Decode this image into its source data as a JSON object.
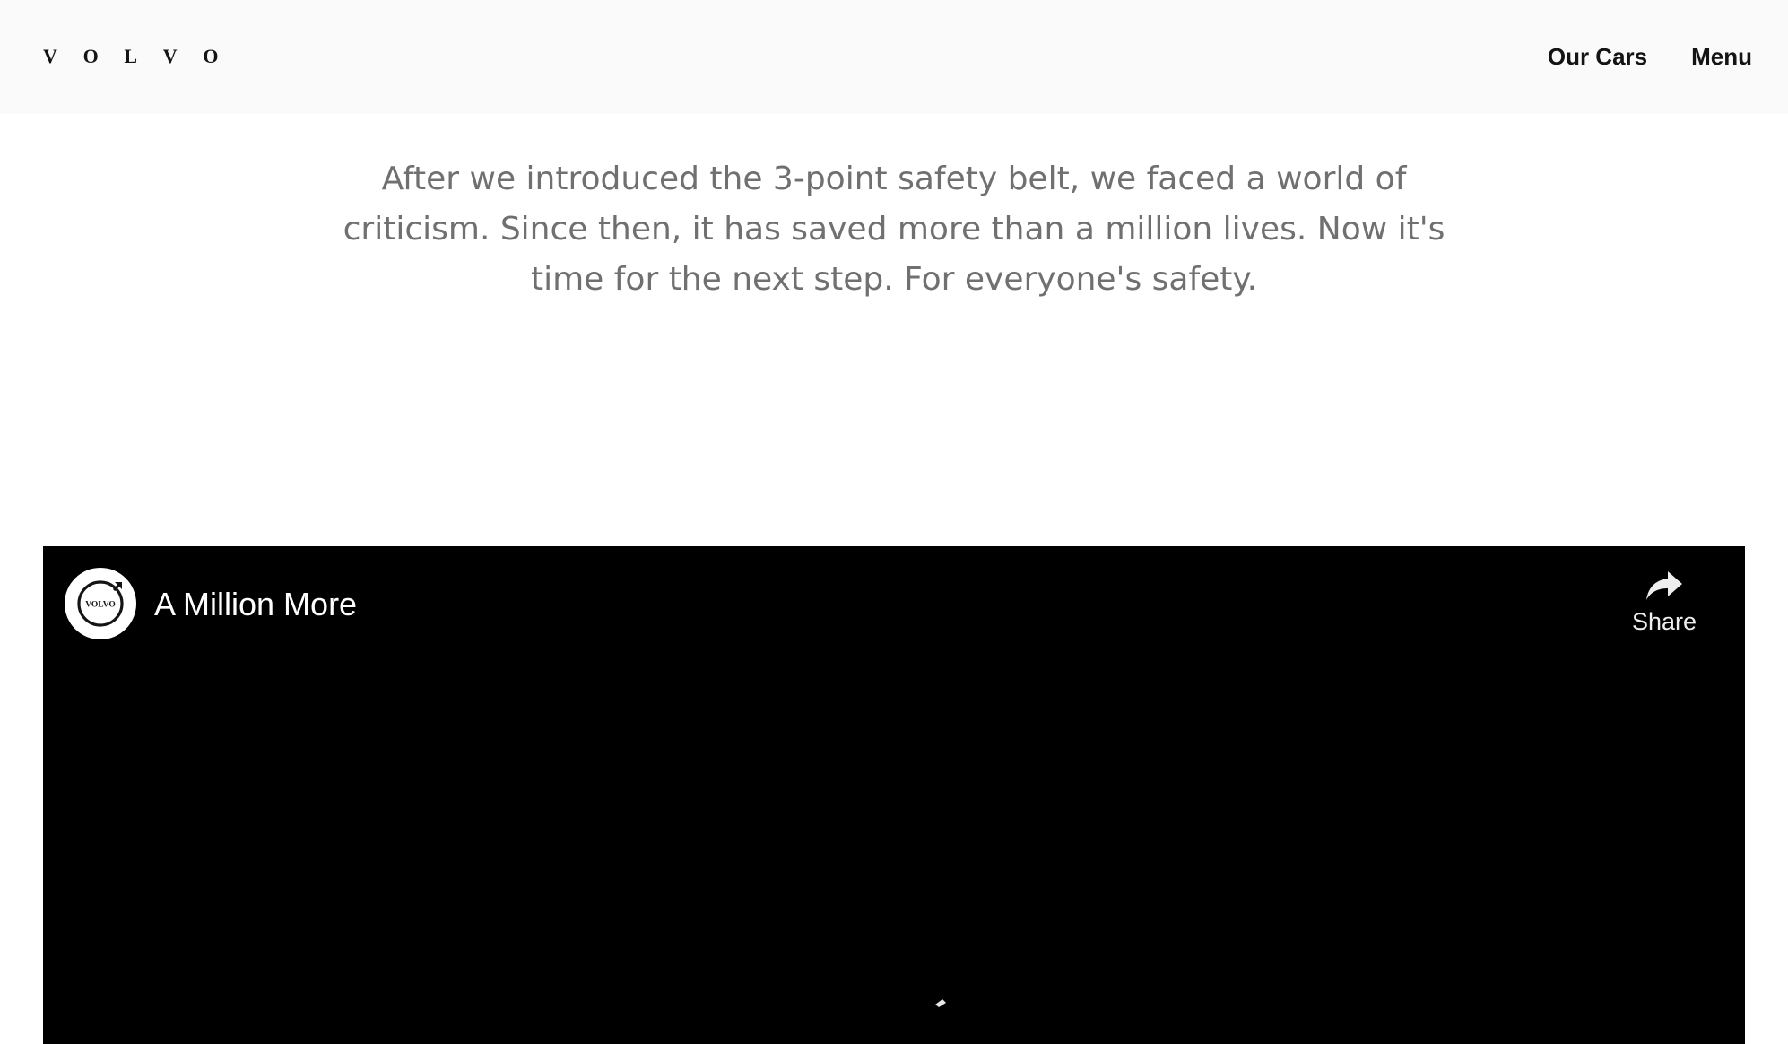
{
  "header": {
    "logo_letters": [
      "V",
      "O",
      "L",
      "V",
      "O"
    ],
    "nav": {
      "our_cars": "Our Cars",
      "menu": "Menu"
    }
  },
  "intro": {
    "text": "After we introduced the 3-point safety belt, we faced a world of criticism. Since then, it has saved more than a million lives. Now it's time for the next step. For everyone's safety."
  },
  "video": {
    "channel_avatar_text": "VOLVO",
    "title": "A Million More",
    "share_label": "Share",
    "state": "loading",
    "icons": {
      "share": "share-arrow-icon",
      "spinner": "loading-spinner-icon"
    }
  },
  "colors": {
    "header_bg": "#fafafa",
    "text_dark": "#141414",
    "intro_text": "#707070",
    "video_bg": "#000000"
  }
}
